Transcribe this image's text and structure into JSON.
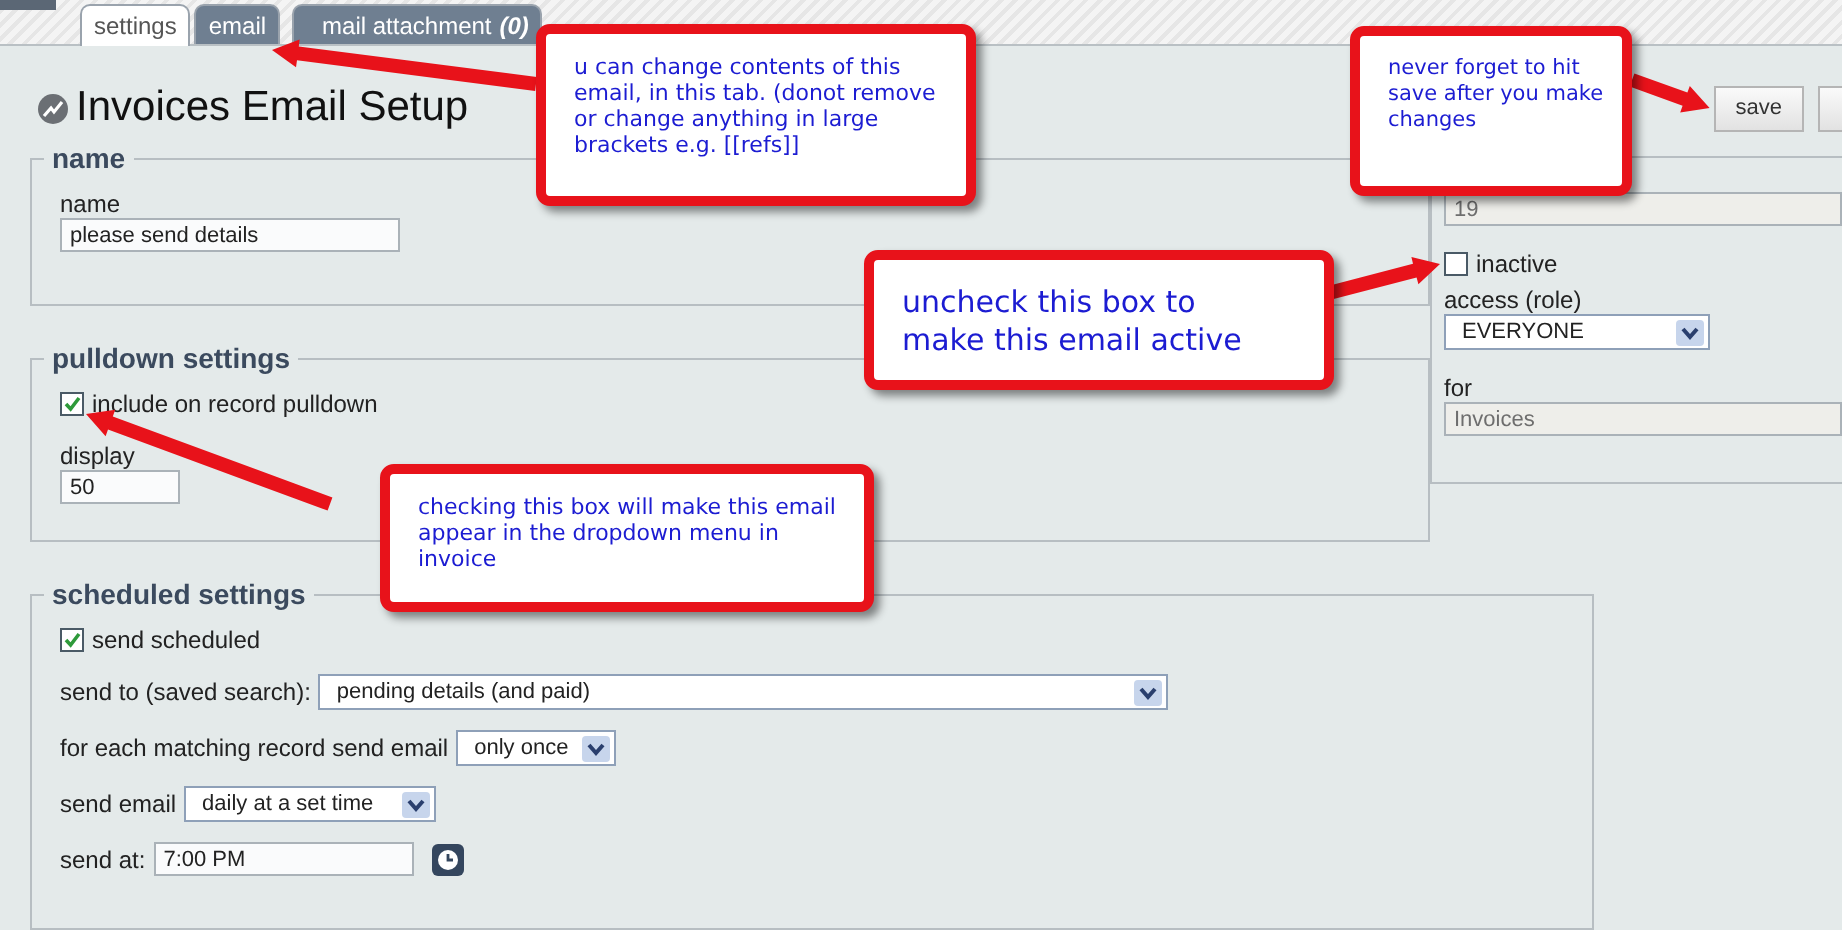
{
  "tabs": [
    {
      "label": "settings",
      "selected": true
    },
    {
      "label": "email",
      "selected": false
    },
    {
      "label": "mail attachment",
      "count": "(0)",
      "selected": false
    }
  ],
  "title": "Invoices Email Setup",
  "save_button": "save",
  "name_section": {
    "legend": "name",
    "label": "name",
    "value": "please send details"
  },
  "pulldown_section": {
    "legend": "pulldown settings",
    "checkbox": {
      "label": "include on record pulldown",
      "checked": true
    },
    "order": {
      "label": "display",
      "value": "50"
    }
  },
  "side_panel": {
    "id_value": "19",
    "inactive": {
      "label": "inactive",
      "checked": false
    },
    "access": {
      "label": "access (role)",
      "value": "EVERYONE"
    },
    "for": {
      "label": "for",
      "value": "Invoices"
    }
  },
  "scheduled_section": {
    "legend": "scheduled settings",
    "checkbox": {
      "label": "send scheduled",
      "checked": true
    },
    "rows": [
      {
        "kind": "select",
        "label": "send to (saved search):",
        "value": "pending details (and paid)"
      },
      {
        "kind": "select",
        "label": "for each matching record send email",
        "value": "only once"
      },
      {
        "kind": "select",
        "label": "send email",
        "value": "daily at a set time"
      },
      {
        "kind": "time",
        "label": "send at:",
        "value": "7:00 PM"
      }
    ]
  },
  "callouts": [
    {
      "text": "u can change contents of this email, in this tab. (donot remove or change anything in large brackets e.g. [[refs]]"
    },
    {
      "text": "never forget to hit save after you make changes"
    },
    {
      "text": "uncheck this box to make this email active"
    },
    {
      "text": "checking this box will make this email appear in the dropdown menu in invoice"
    }
  ]
}
